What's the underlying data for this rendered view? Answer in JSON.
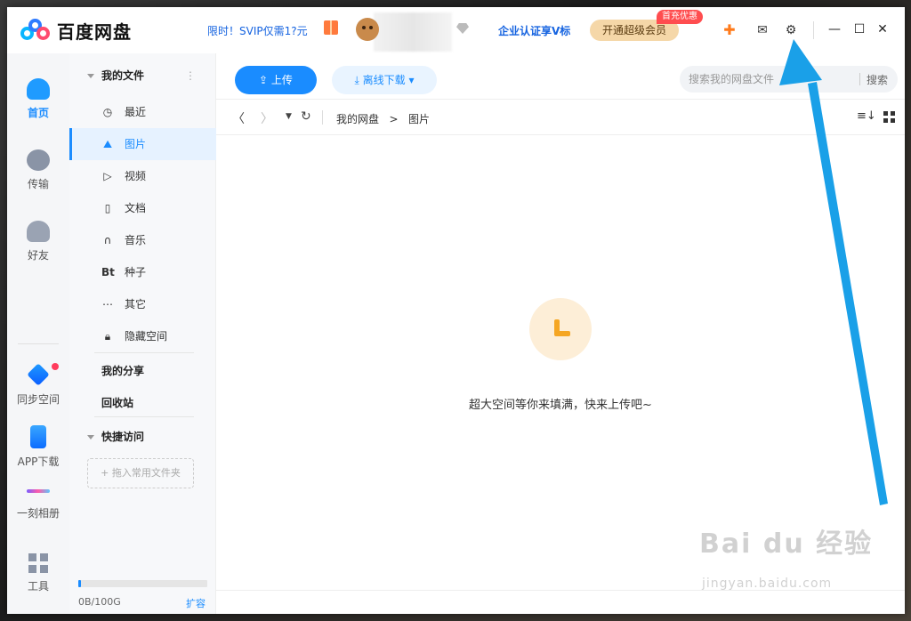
{
  "app": {
    "name": "百度网盘",
    "promo": "限时！SVIP仅需1?元",
    "cert": "企业认证享V标",
    "svip_button": "开通超级会员",
    "svip_badge": "首充优惠"
  },
  "leftnav": {
    "items": [
      {
        "label": "首页"
      },
      {
        "label": "传输"
      },
      {
        "label": "好友"
      },
      {
        "label": "同步空间"
      },
      {
        "label": "APP下载"
      },
      {
        "label": "一刻相册"
      },
      {
        "label": "工具"
      }
    ]
  },
  "filenav": {
    "my_files": "我的文件",
    "items": [
      {
        "label": "最近",
        "icon": "clock-icon"
      },
      {
        "label": "图片",
        "icon": "image-icon"
      },
      {
        "label": "视频",
        "icon": "play-icon"
      },
      {
        "label": "文档",
        "icon": "doc-icon"
      },
      {
        "label": "音乐",
        "icon": "headphone-icon"
      },
      {
        "label": "种子",
        "icon": "bt-icon",
        "glyph": "Bt"
      },
      {
        "label": "其它",
        "icon": "dots-icon"
      },
      {
        "label": "隐藏空间",
        "icon": "lock-icon"
      }
    ],
    "my_share": "我的分享",
    "recycle": "回收站",
    "quick_access": "快捷访问",
    "drop_hint": "+ 拖入常用文件夹",
    "quota": "0B/100G",
    "quota_fraction": 0.01,
    "expand": "扩容"
  },
  "main": {
    "upload": "上传",
    "offline": "离线下载",
    "search_placeholder": "搜索我的网盘文件",
    "search_btn": "搜索",
    "breadcrumb": [
      "我的网盘",
      "图片"
    ],
    "empty_text": "超大空间等你来填满，快来上传吧~"
  },
  "watermark": {
    "text": "Bai du 经验",
    "sub": "jingyan.baidu.com"
  },
  "colors": {
    "accent": "#1a8cff",
    "arrow": "#1aa0e8"
  }
}
